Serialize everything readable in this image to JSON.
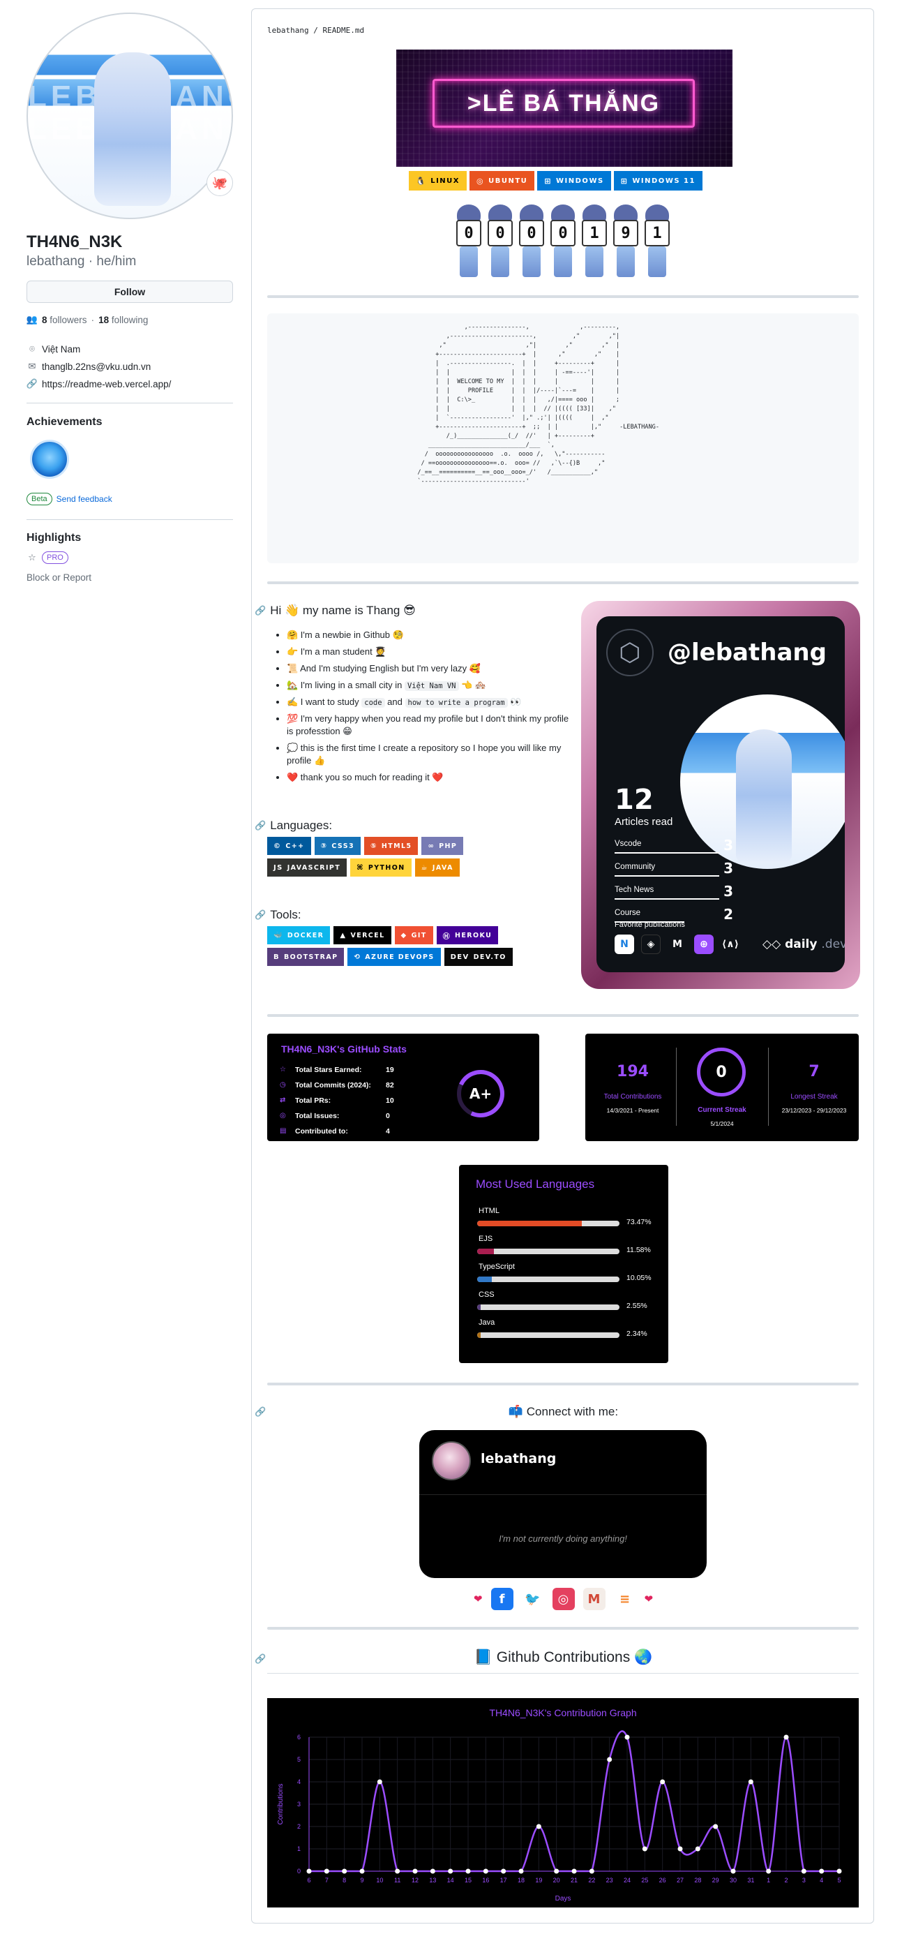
{
  "profile": {
    "name": "TH4N6_N3K",
    "login": "lebathang · he/him",
    "follow_label": "Follow",
    "followers_count": "8",
    "followers_label": "followers",
    "following_count": "18",
    "following_label": "following",
    "location": "Việt Nam",
    "email": "thanglb.22ns@vku.udn.vn",
    "website": "https://readme-web.vercel.app/",
    "achievements_title": "Achievements",
    "beta_label": "Beta",
    "feedback_label": "Send feedback",
    "highlights_title": "Highlights",
    "pro_label": "PRO",
    "block_label": "Block or Report",
    "avatar_banner_text": "LEBATHANG"
  },
  "readme": {
    "path_user": "lebathang",
    "path_sep": " / ",
    "path_file": "README.md",
    "hero_text": ">LÊ BÁ THẮNG",
    "os_badges": [
      {
        "label": "LINUX",
        "icon": "linux-icon",
        "color": "#FCC624",
        "text_color": "#000000",
        "sym": "🐧"
      },
      {
        "label": "UBUNTU",
        "icon": "ubuntu-icon",
        "color": "#E95420",
        "text_color": "#FFFFFF",
        "sym": "◎"
      },
      {
        "label": "WINDOWS",
        "icon": "windows-icon",
        "color": "#0078D6",
        "text_color": "#FFFFFF",
        "sym": "⊞"
      },
      {
        "label": "WINDOWS 11",
        "icon": "windows-icon",
        "color": "#0078D4",
        "text_color": "#FFFFFF",
        "sym": "⊞"
      }
    ],
    "counter_digits": [
      "0",
      "0",
      "0",
      "0",
      "1",
      "9",
      "1"
    ],
    "ascii_art": "               ,----------------,              ,---------,\n          ,-----------------------,          ,\"        ,\"|\n        ,\"                      ,\"|        ,\"        ,\"  |\n       +-----------------------+  |      ,\"        ,\"    |\n       |  .-----------------.  |  |     +---------+      |\n       |  |                 |  |  |     | -==----'|      |\n       |  |  WELCOME TO MY  |  |  |     |         |      |\n       |  |     PROFILE     |  |  |/----|`---=    |      |\n       |  |  C:\\>_          |  |  |   ,/|==== ooo |      ;\n       |  |                 |  |  |  // |(((( [33]|    ,\"\n       |  `-----------------'  |,\" .;'| |((((     |  ,\"\n       +-----------------------+  ;;  | |         |,\"     -LEBATHANG-\n          /_)______________(_/  //'   | +---------+\n     ___________________________/___  `,\n    /  oooooooooooooooo  .o.  oooo /,   \\,\"-----------\n   / ==ooooooooooooooo==.o.  ooo= //   ,`\\--{)B     ,\"\n  /_==__==========__==_ooo__ooo=_/'   /___________,\"\n  `-----------------------------'",
    "intro_title": "Hi 👋 my name is Thang 😎",
    "intro_items": [
      "🤗 I'm a newbie in Github 🧐",
      "👉 I'm a man student 🧑‍🎓",
      "📜 And I'm studying English but I'm very lazy 🥰",
      "🏡 I'm living in a small city in",
      "✍️ I want to study",
      "💯 I'm very happy when you read my profile but I don't think my profile is professtion 😁",
      "💭 this is the first time I create a repository so I hope you will like my profile 👍",
      "❤️ thank you so much for reading it ❤️"
    ],
    "intro_code": {
      "city": "Việt Nam VN",
      "city_tail": "👈 🏘️",
      "code1": "code",
      "and": "and",
      "code2": "how to write a program",
      "tail": "👀"
    },
    "languages_title": "Languages:",
    "languages": [
      {
        "label": "C++",
        "color": "#00599C",
        "sym": "©"
      },
      {
        "label": "CSS3",
        "color": "#1572B6",
        "sym": "③"
      },
      {
        "label": "HTML5",
        "color": "#E34F26",
        "sym": "⑤"
      },
      {
        "label": "PHP",
        "color": "#777BB4",
        "sym": "∞"
      },
      {
        "label": "JAVASCRIPT",
        "color": "#323330",
        "sym": "JS"
      },
      {
        "label": "PYTHON",
        "color": "#FFD43B",
        "text": "#000000",
        "sym": "⌘"
      },
      {
        "label": "JAVA",
        "color": "#ED8B00",
        "sym": "☕"
      }
    ],
    "tools_title": "Tools:",
    "tools": [
      {
        "label": "DOCKER",
        "color": "#0DB7ED",
        "sym": "🐳"
      },
      {
        "label": "VERCEL",
        "color": "#000000",
        "sym": "▲"
      },
      {
        "label": "GIT",
        "color": "#F05033",
        "sym": "◆"
      },
      {
        "label": "HEROKU",
        "color": "#430098",
        "sym": "Ⓗ"
      },
      {
        "label": "BOOTSTRAP",
        "color": "#563D7C",
        "sym": "B"
      },
      {
        "label": "AZURE DEVOPS",
        "color": "#0078D7",
        "sym": "⟲"
      },
      {
        "label": "DEV.TO",
        "color": "#0A0A0A",
        "sym": "DEV"
      }
    ],
    "devcard": {
      "handle": "@lebathang",
      "reads": "12",
      "reads_label": "Articles read",
      "tags": [
        {
          "name": "Vscode",
          "count": "3"
        },
        {
          "name": "Community",
          "count": "3"
        },
        {
          "name": "Tech News",
          "count": "3"
        },
        {
          "name": "Course",
          "count": "2"
        }
      ],
      "fav_label": "Favorite publications",
      "brand": "daily",
      "brand_suffix": ".dev"
    },
    "gh_stats": {
      "title": "TH4N6_N3K's GitHub Stats",
      "rows": [
        {
          "label": "Total Stars Earned:",
          "value": "19",
          "icon": "star-icon"
        },
        {
          "label": "Total Commits (2024):",
          "value": "82",
          "icon": "clock-icon"
        },
        {
          "label": "Total PRs:",
          "value": "10",
          "icon": "pr-icon"
        },
        {
          "label": "Total Issues:",
          "value": "0",
          "icon": "issue-icon"
        },
        {
          "label": "Contributed to:",
          "value": "4",
          "icon": "repo-icon"
        }
      ],
      "grade": "A+"
    },
    "streak": {
      "total": "194",
      "total_label": "Total Contributions",
      "total_range": "14/3/2021 - Present",
      "current": "0",
      "current_label": "Current Streak",
      "current_date": "5/1/2024",
      "longest": "7",
      "longest_label": "Longest Streak",
      "longest_range": "23/12/2023 - 29/12/2023"
    },
    "top_langs": {
      "title": "Most Used Languages",
      "items": [
        {
          "name": "HTML",
          "pct": "73.47%",
          "value": 73.47,
          "color": "#e34c26"
        },
        {
          "name": "EJS",
          "pct": "11.58%",
          "value": 11.58,
          "color": "#a91e50"
        },
        {
          "name": "TypeScript",
          "pct": "10.05%",
          "value": 10.05,
          "color": "#3178c6"
        },
        {
          "name": "CSS",
          "pct": "2.55%",
          "value": 2.55,
          "color": "#563d7c"
        },
        {
          "name": "Java",
          "pct": "2.34%",
          "value": 2.34,
          "color": "#b07219"
        }
      ]
    },
    "connect_title": "📫 Connect with me:",
    "discord": {
      "name": "lebathang",
      "status": "I'm not currently doing anything!"
    },
    "socials": [
      {
        "icon": "facebook-icon",
        "sym": "f",
        "color": "#1877F2"
      },
      {
        "icon": "twitter-icon",
        "sym": "🐦",
        "color": "#ffffff"
      },
      {
        "icon": "instagram-icon",
        "sym": "◎",
        "color": "#E4405F"
      },
      {
        "icon": "gmail-icon",
        "sym": "M",
        "color": "#f4ede8"
      },
      {
        "icon": "stackoverflow-icon",
        "sym": "≡",
        "color": "#ffffff"
      }
    ],
    "contrib_title": "📘 Github Contributions 🌏"
  },
  "chart_data": {
    "type": "line",
    "title": "TH4N6_N3K's Contribution Graph",
    "xlabel": "Days",
    "ylabel": "Contributions",
    "x": [
      "6",
      "7",
      "8",
      "9",
      "10",
      "11",
      "12",
      "13",
      "14",
      "15",
      "16",
      "17",
      "18",
      "19",
      "20",
      "21",
      "22",
      "23",
      "24",
      "25",
      "26",
      "27",
      "28",
      "29",
      "30",
      "31",
      "1",
      "2",
      "3",
      "4",
      "5"
    ],
    "series": [
      {
        "values": [
          0,
          0,
          0,
          0,
          4,
          0,
          0,
          0,
          0,
          0,
          0,
          0,
          0,
          2,
          0,
          0,
          0,
          5,
          6,
          1,
          4,
          1,
          1,
          2,
          0,
          4,
          0,
          6,
          0,
          0,
          0
        ]
      }
    ],
    "ylim": [
      0,
      6
    ],
    "yticks": [
      "0",
      "1",
      "2",
      "3",
      "4",
      "5",
      "6"
    ],
    "color": "#9b4dff",
    "grid": true
  }
}
